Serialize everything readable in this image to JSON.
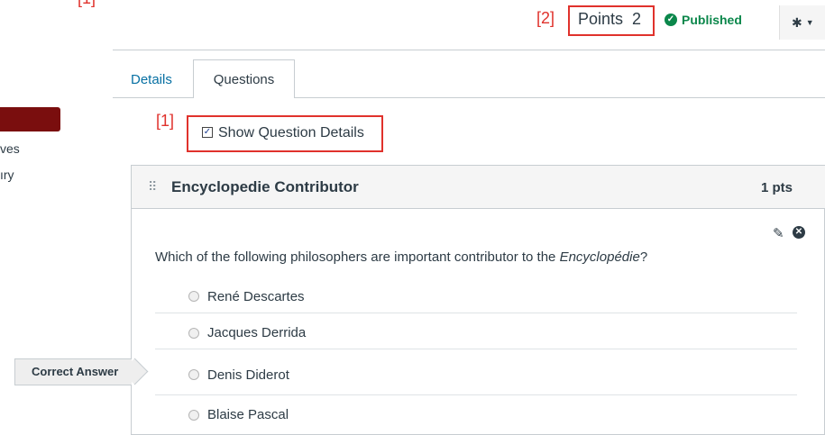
{
  "annotations": {
    "label_1": "[1]",
    "label_2": "[2]"
  },
  "header": {
    "points_text": "Points  2",
    "published_label": "Published",
    "published_icon": "check-circle-icon",
    "settings_icon": "gear-icon"
  },
  "tabs": [
    {
      "label": "Details"
    },
    {
      "label": "Questions"
    }
  ],
  "sidebar": {
    "partial_item_1": "ves",
    "partial_item_2": "ıry",
    "active_bar_color": "#7a0e0e"
  },
  "show_details": {
    "label": "Show Question Details",
    "checked": true
  },
  "question": {
    "title": "Encyclopedie Contributor",
    "points": "1 pts",
    "text_before": "Which of the following philosophers are important contributor to the ",
    "text_emphasis": "Encyclopédie",
    "text_after": "?",
    "answers": [
      {
        "label": "René Descartes"
      },
      {
        "label": "Jacques Derrida"
      },
      {
        "label": "Denis Diderot",
        "correct": true
      },
      {
        "label": "Blaise Pascal"
      }
    ]
  },
  "correct_flag": {
    "label": "Correct Answer"
  },
  "colors": {
    "published_green": "#0b874b",
    "link_blue": "#0770a3",
    "annotation_red": "#e0322c"
  }
}
